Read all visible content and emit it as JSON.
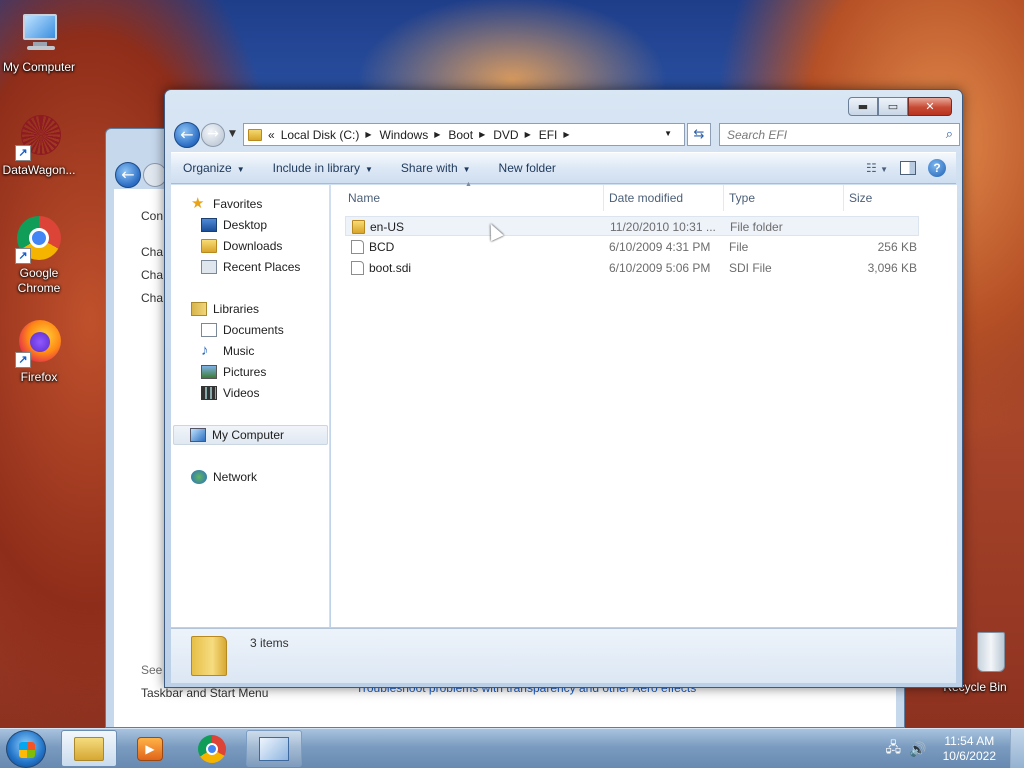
{
  "desktop": {
    "icons": [
      {
        "label": "My Computer"
      },
      {
        "label": "DataWagon..."
      },
      {
        "label": "Google Chrome"
      },
      {
        "label": "Firefox"
      },
      {
        "label": "Recycle Bin"
      }
    ]
  },
  "background_window": {
    "texts": [
      "Con",
      "Cha",
      "Cha",
      "Cha",
      "See",
      "Taskbar and Start Menu",
      "Troubleshoot problems with transparency and other Aero effects"
    ]
  },
  "explorer": {
    "address": {
      "overflow": "«",
      "crumbs": [
        "Local Disk (C:)",
        "Windows",
        "Boot",
        "DVD",
        "EFI"
      ]
    },
    "search_placeholder": "Search EFI",
    "toolbar": {
      "organize": "Organize",
      "include_in_library": "Include in library",
      "share_with": "Share with",
      "new_folder": "New folder"
    },
    "nav": {
      "favorites": "Favorites",
      "desktop": "Desktop",
      "downloads": "Downloads",
      "recent_places": "Recent Places",
      "libraries": "Libraries",
      "documents": "Documents",
      "music": "Music",
      "pictures": "Pictures",
      "videos": "Videos",
      "my_computer": "My Computer",
      "network": "Network"
    },
    "columns": [
      "Name",
      "Date modified",
      "Type",
      "Size"
    ],
    "files": [
      {
        "name": "en-US",
        "date": "11/20/2010 10:31 ...",
        "type": "File folder",
        "size": ""
      },
      {
        "name": "BCD",
        "date": "6/10/2009 4:31 PM",
        "type": "File",
        "size": "256 KB"
      },
      {
        "name": "boot.sdi",
        "date": "6/10/2009 5:06 PM",
        "type": "SDI File",
        "size": "3,096 KB"
      }
    ],
    "status": "3 items"
  },
  "taskbar": {
    "time": "11:54 AM",
    "date": "10/6/2022"
  }
}
